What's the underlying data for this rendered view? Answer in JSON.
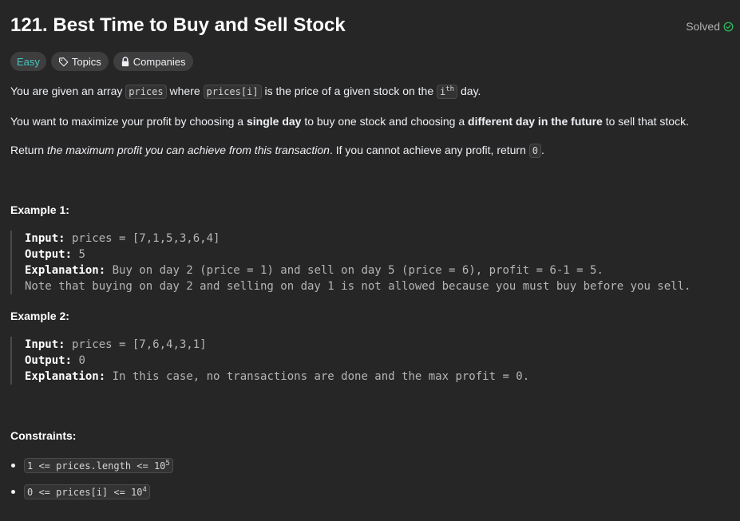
{
  "problem": {
    "title": "121. Best Time to Buy and Sell Stock",
    "status": "Solved",
    "colors": {
      "easy": "#46c6c2",
      "solved": "#2cbb5d",
      "background": "#262626"
    }
  },
  "tags": {
    "difficulty": "Easy",
    "topics": "Topics",
    "companies": "Companies",
    "icons": [
      "tag-icon",
      "lock-icon",
      "check-circle-icon"
    ]
  },
  "description": {
    "p1_a": "You are given an array ",
    "p1_code1": "prices",
    "p1_b": " where ",
    "p1_code2": "prices[i]",
    "p1_c": " is the price of a given stock on the ",
    "p1_code3_base": "i",
    "p1_code3_sup": "th",
    "p1_d": " day.",
    "p2_a": "You want to maximize your profit by choosing a ",
    "p2_b": "single day",
    "p2_c": " to buy one stock and choosing a ",
    "p2_d": "different day in the future",
    "p2_e": " to sell that stock.",
    "p3_a": "Return ",
    "p3_b": "the maximum profit you can achieve from this transaction",
    "p3_c": ". If you cannot achieve any profit, return ",
    "p3_code": "0",
    "p3_d": "."
  },
  "examples": [
    {
      "heading": "Example 1:",
      "input_label": "Input:",
      "input_value": " prices = [7,1,5,3,6,4]",
      "output_label": "Output:",
      "output_value": " 5",
      "explanation_label": "Explanation:",
      "explanation_value": " Buy on day 2 (price = 1) and sell on day 5 (price = 6), profit = 6-1 = 5.",
      "note": "Note that buying on day 2 and selling on day 1 is not allowed because you must buy before you sell."
    },
    {
      "heading": "Example 2:",
      "input_label": "Input:",
      "input_value": " prices = [7,6,4,3,1]",
      "output_label": "Output:",
      "output_value": " 0",
      "explanation_label": "Explanation:",
      "explanation_value": " In this case, no transactions are done and the max profit = 0."
    }
  ],
  "constraints": {
    "heading": "Constraints:",
    "c1_base": "1 <= prices.length <= 10",
    "c1_sup": "5",
    "c2_base": "0 <= prices[i] <= 10",
    "c2_sup": "4"
  }
}
